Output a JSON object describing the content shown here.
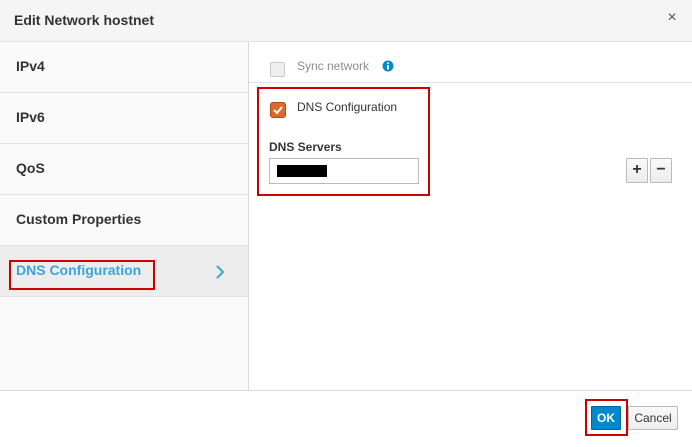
{
  "dialog": {
    "title": "Edit Network hostnet",
    "close_glyph": "×"
  },
  "sidebar": {
    "items": [
      {
        "label": "IPv4"
      },
      {
        "label": "IPv6"
      },
      {
        "label": "QoS"
      },
      {
        "label": "Custom Properties"
      },
      {
        "label": "DNS Configuration",
        "active": true
      }
    ]
  },
  "sync": {
    "label": "Sync network",
    "checked": false,
    "disabled": true,
    "info_icon": "info-icon"
  },
  "dns": {
    "checkbox_label": "DNS Configuration",
    "checked": true,
    "servers_label": "DNS Servers",
    "server_value_redacted": true,
    "add_glyph": "+",
    "remove_glyph": "−"
  },
  "footer": {
    "ok_label": "OK",
    "cancel_label": "Cancel"
  },
  "colors": {
    "accent": "#0088ce",
    "active_nav_text": "#39a5dc",
    "checkbox_checked": "#d96a2b",
    "highlight": "#cc0000"
  }
}
